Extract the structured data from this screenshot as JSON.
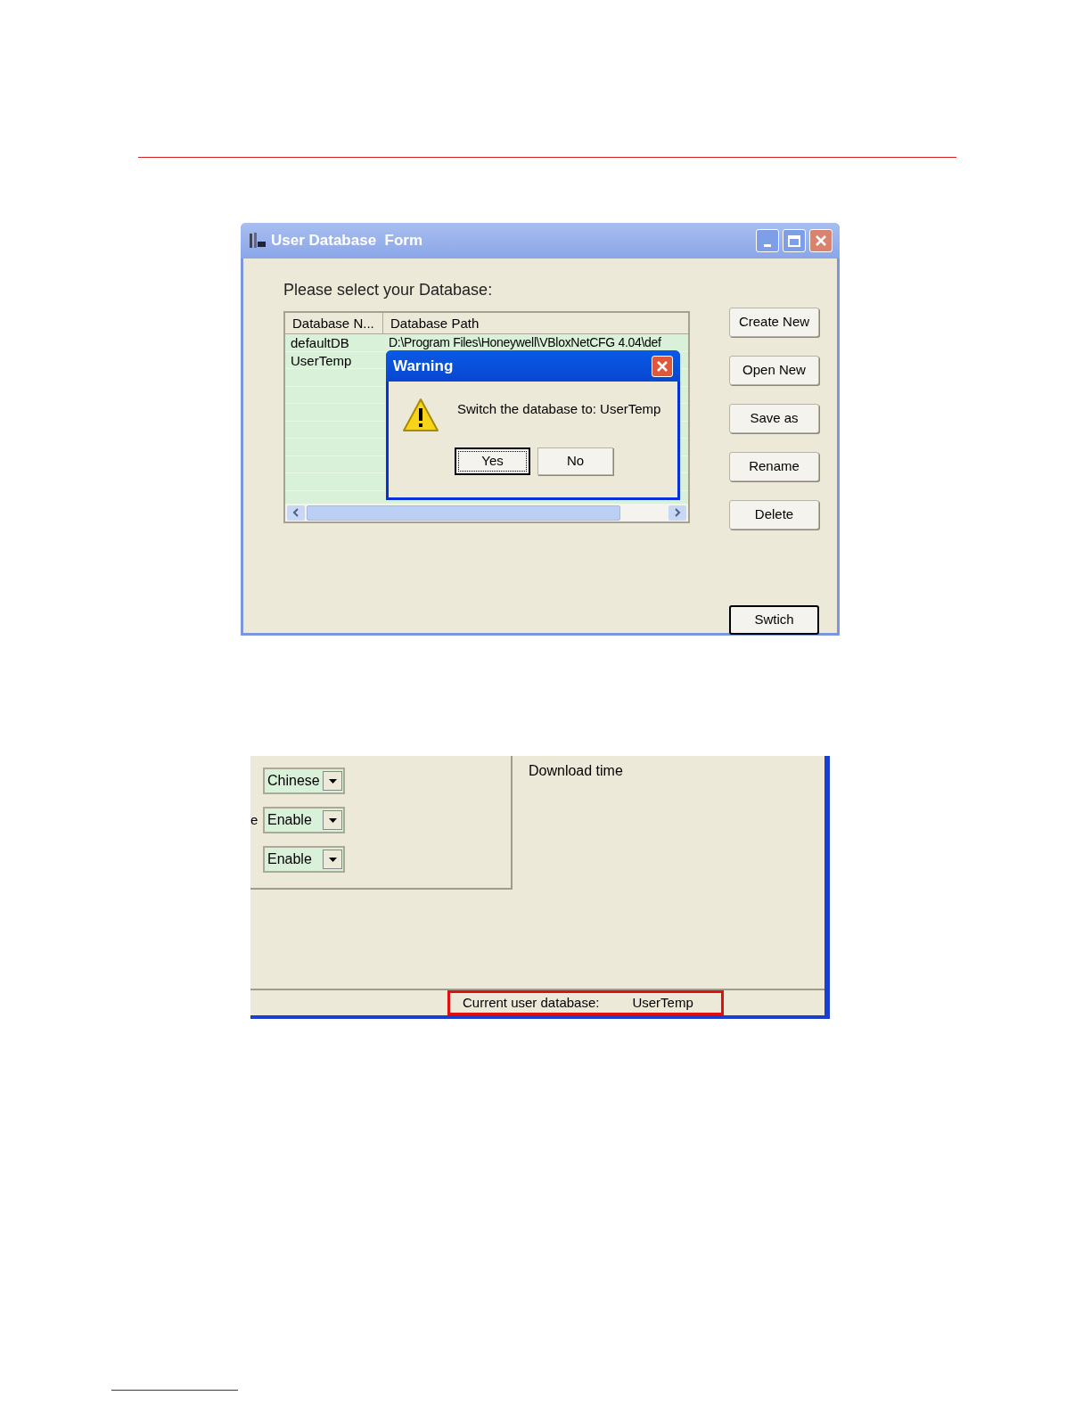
{
  "window": {
    "title": "User Database  Form",
    "prompt": "Please select your Database:",
    "table": {
      "columns": [
        "Database N...",
        "Database Path"
      ],
      "rows": [
        {
          "name": "defaultDB",
          "path": "D:\\Program Files\\Honeywell\\VBloxNetCFG 4.04\\def"
        },
        {
          "name": "UserTemp"
        }
      ]
    },
    "buttons": [
      {
        "label": "Create New",
        "default": false
      },
      {
        "label": "Open New",
        "default": false
      },
      {
        "label": "Save as",
        "default": false
      },
      {
        "label": "Rename",
        "default": false
      },
      {
        "label": "Delete",
        "default": false
      },
      {
        "label": "Swtich",
        "default": true
      }
    ],
    "dialog": {
      "title": "Warning",
      "message": "Switch the database to: UserTemp",
      "buttons": [
        {
          "label": "Yes",
          "focused": true
        },
        {
          "label": "No",
          "focused": false
        }
      ]
    }
  },
  "settings_screenshot": {
    "combos": [
      {
        "value": "Chinese"
      },
      {
        "label": "e",
        "value": "Enable"
      },
      {
        "value": "Enable"
      }
    ],
    "note": "Download time",
    "status_bar": {
      "label": "Current user database:",
      "value": "UserTemp"
    }
  }
}
